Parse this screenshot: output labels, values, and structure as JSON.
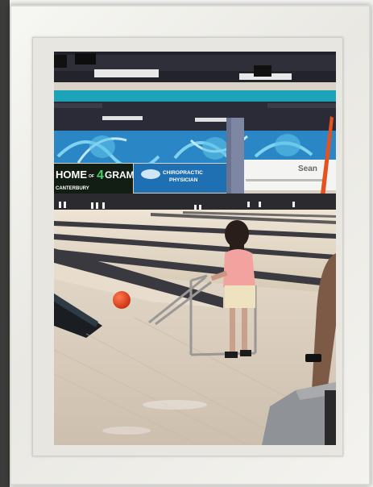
{
  "photo": {
    "signs": {
      "home_banner": "HOME",
      "home_banner_of": "OF",
      "home_banner_number": "4",
      "home_banner_gram": "GRAM",
      "home_banner_sub": "CANTERBURY",
      "chiro_title": "CHIROPRACTIC",
      "chiro_sub": "PHYSICIAN",
      "right_sign": "Sean"
    }
  },
  "colors": {
    "frame": "#f2f1ec",
    "ceiling": "#1f1f28",
    "teal_band": "#1da3b8",
    "mural_blue": "#2a86c4",
    "lane_wood": "#d9cfc0",
    "ball": "#e0401f",
    "shirt": "#f2a3a0"
  }
}
